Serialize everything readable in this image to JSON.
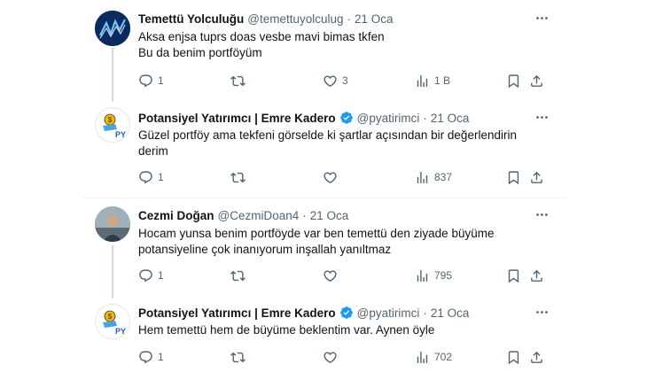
{
  "tweets": [
    {
      "name": "Temettü Yolculuğu",
      "handle": "@temettuyolculug",
      "dot": "·",
      "date": "21 Oca",
      "lines": [
        "Aksa enjsa tuprs doas vesbe mavi bimas tkfen",
        "Bu da benim portföyüm"
      ],
      "replies": "1",
      "retweets": "",
      "likes": "3",
      "views": "1 B",
      "verified": false
    },
    {
      "name": "Potansiyel Yatırımcı | Emre Kadero",
      "handle": "@pyatirimci",
      "dot": "·",
      "date": "21 Oca",
      "lines": [
        "Güzel portföy ama tekfeni görselde ki şartlar açısından bir değerlendirin",
        "derim"
      ],
      "replies": "1",
      "retweets": "",
      "likes": "",
      "views": "837",
      "verified": true
    },
    {
      "name": "Cezmi Doğan",
      "handle": "@CezmiDoan4",
      "dot": "·",
      "date": "21 Oca",
      "lines": [
        "Hocam yunsa benim portföyde var ben temettü den ziyade büyüme",
        "potansiyeline çok inanıyorum inşallah yanıltmaz"
      ],
      "replies": "1",
      "retweets": "",
      "likes": "",
      "views": "795",
      "verified": false
    },
    {
      "name": "Potansiyel Yatırımcı | Emre Kadero",
      "handle": "@pyatirimci",
      "dot": "·",
      "date": "21 Oca",
      "lines": [
        "Hem temettü hem de büyüme beklentim var. Aynen öyle"
      ],
      "replies": "1",
      "retweets": "",
      "likes": "",
      "views": "702",
      "verified": true
    }
  ],
  "colors": {
    "text": "#0f1419",
    "muted": "#536471",
    "verified": "#1d9bf0",
    "thread_line": "#cfd9de"
  }
}
